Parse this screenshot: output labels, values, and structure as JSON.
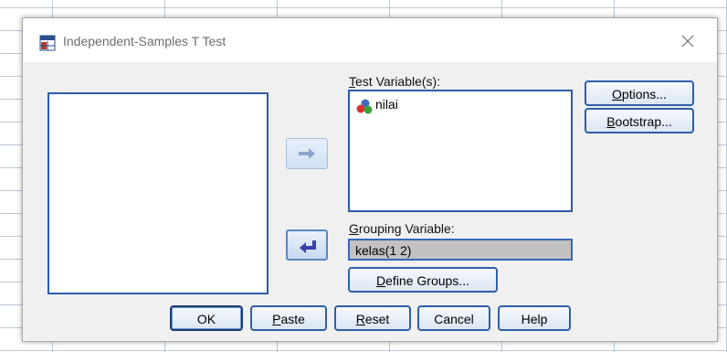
{
  "dialog": {
    "title": "Independent-Samples T Test",
    "app_icon": "spss-dialog-icon",
    "close_icon": "close-icon"
  },
  "source_list": {
    "items": []
  },
  "test_variables": {
    "label_underline": "T",
    "label_rest": "est Variable(s):",
    "items": [
      {
        "label": "nilai",
        "icon": "scale-variable-icon"
      }
    ]
  },
  "grouping": {
    "label_underline": "G",
    "label_rest": "rouping Variable:",
    "value": "kelas(1 2)"
  },
  "buttons": {
    "options_underline": "O",
    "options_rest": "ptions...",
    "bootstrap_underline": "B",
    "bootstrap_rest": "ootstrap...",
    "define_underline": "D",
    "define_rest": "efine Groups...",
    "ok": "OK",
    "paste_underline": "P",
    "paste_rest": "aste",
    "reset_underline": "R",
    "reset_rest": "eset",
    "cancel": "Cancel",
    "help": "Help"
  },
  "arrows": {
    "move_to_test": "arrow-right-icon",
    "move_to_grouping": "arrow-left-icon"
  }
}
